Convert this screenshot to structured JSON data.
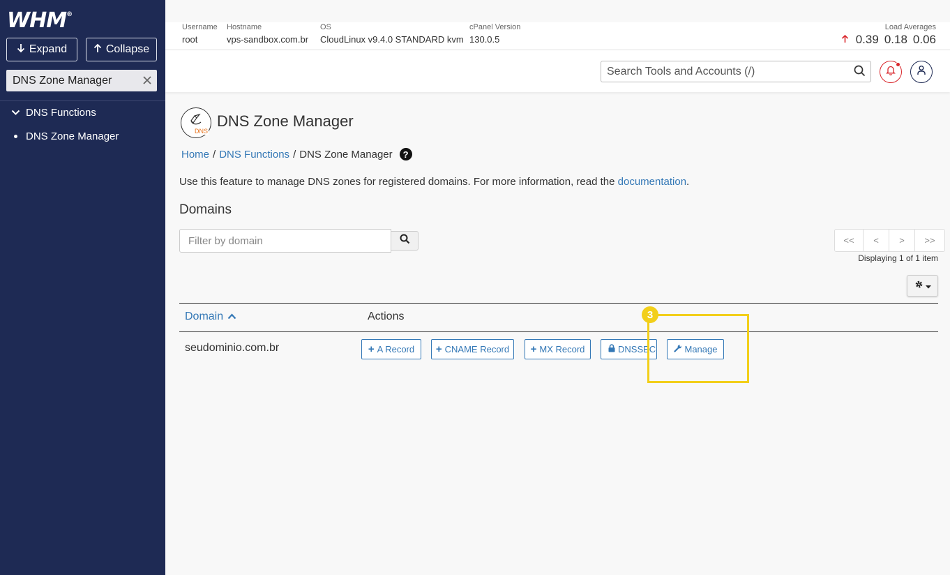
{
  "app": {
    "logo": "WHM",
    "logo_mark": "®"
  },
  "sidebar": {
    "expand_label": "Expand",
    "collapse_label": "Collapse",
    "search_value": "DNS Zone Manager",
    "group_label": "DNS Functions",
    "items": [
      {
        "label": "DNS Zone Manager"
      }
    ]
  },
  "server_info": {
    "username_label": "Username",
    "username": "root",
    "hostname_label": "Hostname",
    "hostname": "vps-sandbox.com.br",
    "os_label": "OS",
    "os": "CloudLinux v9.4.0 STANDARD kvm",
    "cpanel_label": "cPanel Version",
    "cpanel_version": "130.0.5",
    "load_label": "Load Averages",
    "load": [
      "0.39",
      "0.18",
      "0.06"
    ]
  },
  "header": {
    "search_placeholder": "Search Tools and Accounts (/)"
  },
  "page": {
    "title": "DNS Zone Manager",
    "icon_text": "DNS",
    "breadcrumb": {
      "home": "Home",
      "sep": "/",
      "section": "DNS Functions",
      "current": "DNS Zone Manager"
    },
    "help_glyph": "?",
    "description_prefix": "Use this feature to manage DNS zones for registered domains. For more information, read the ",
    "description_link": "documentation",
    "description_suffix": ".",
    "section_title": "Domains",
    "filter_placeholder": "Filter by domain",
    "pager": {
      "first": "<<",
      "prev": "<",
      "next": ">",
      "last": ">>"
    },
    "displaying": "Displaying 1 of 1 item"
  },
  "table": {
    "col_domain": "Domain",
    "col_actions": "Actions",
    "rows": [
      {
        "domain": "seudominio.com.br"
      }
    ],
    "actions": {
      "a_record": "A Record",
      "cname_record": "CNAME Record",
      "mx_record": "MX Record",
      "dnssec": "DNSSEC",
      "manage": "Manage"
    }
  },
  "annotation": {
    "step": "3",
    "color": "#f2cf1a"
  },
  "colors": {
    "sidebar": "#1e2a54",
    "link": "#3478b6",
    "alert": "#d9262b"
  }
}
